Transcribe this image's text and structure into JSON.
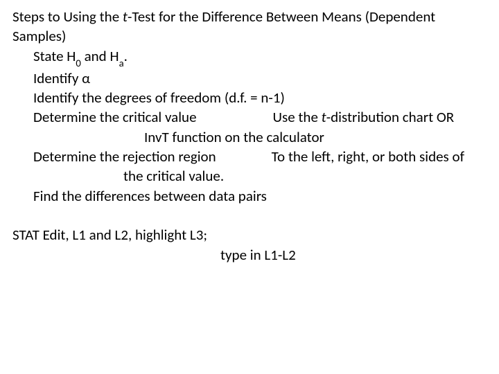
{
  "title_part1": "Steps to Using the ",
  "title_t": "t",
  "title_part2": "-Test for the Difference Between Means (Dependent Samples)",
  "step1_a": "State H",
  "step1_sub0": "0",
  "step1_b": " and H",
  "step1_suba": "a",
  "step1_c": ".",
  "step2": "Identify α",
  "step3": "Identify the degrees of freedom (d.f. = n-1)",
  "step4_a": "Determine the critical value",
  "step4_b": "Use the ",
  "step4_t": "t",
  "step4_c": "-distribution chart OR",
  "step4_d": "InvT function on the calculator",
  "step5_a": "Determine the rejection region",
  "step5_b": "To the left, right, or both sides of",
  "step5_c": "the critical value.",
  "step6": "Find the differences between data pairs",
  "step6_b": "STAT Edit, L1 and L2, highlight L3;",
  "step6_c": "type in L1-L2"
}
